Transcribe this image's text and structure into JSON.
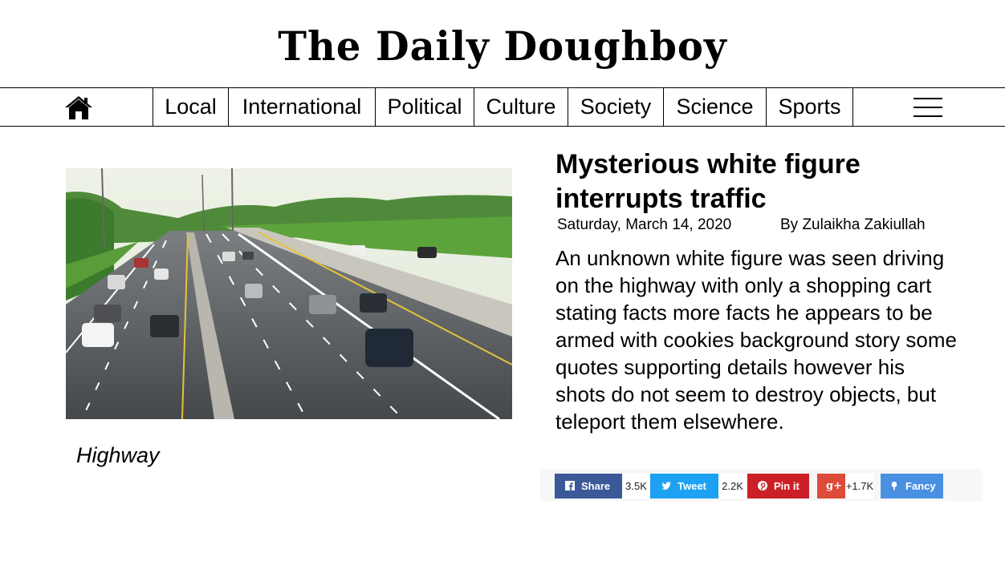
{
  "masthead": {
    "title": "The Daily Doughboy"
  },
  "nav": {
    "home_icon": "home-icon",
    "items": [
      "Local",
      "International",
      "Political",
      "Culture",
      "Society",
      "Science",
      "Sports"
    ],
    "menu_icon": "hamburger-menu-icon"
  },
  "article": {
    "image_caption": "Highway",
    "headline": "Mysterious white figure interrupts traffic",
    "date": "Saturday, March 14, 2020",
    "byline": "By Zulaikha Zakiullah",
    "body": "An unknown white figure was seen driving on the highway with only a shopping cart stating facts more facts he appears to be armed with cookies background story some quotes supporting details however his shots do not seem to destroy objects, but teleport them elsewhere."
  },
  "share": {
    "facebook": {
      "label": "Share",
      "count": "3.5K",
      "color": "#3b5998",
      "icon": "facebook-icon"
    },
    "twitter": {
      "label": "Tweet",
      "count": "2.2K",
      "color": "#1da1f2",
      "icon": "twitter-icon"
    },
    "pinterest": {
      "label": "Pin it",
      "color": "#cb2027",
      "icon": "pinterest-icon"
    },
    "googleplus": {
      "label": "g+",
      "count": "+1.7K",
      "color": "#dd4b39",
      "icon": "google-plus-icon"
    },
    "fancy": {
      "label": "Fancy",
      "color": "#4a90e2",
      "icon": "fancy-icon"
    }
  }
}
